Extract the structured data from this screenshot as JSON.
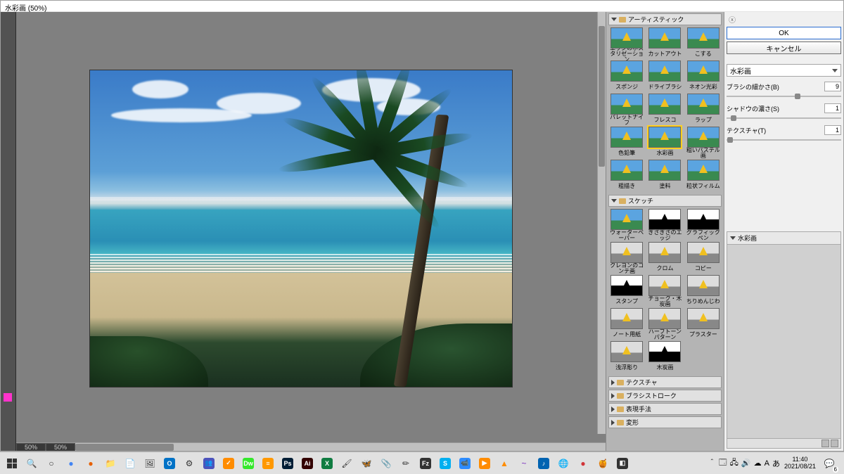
{
  "window": {
    "title": "水彩画 (50%)"
  },
  "zoom_readout": "50%",
  "bottom_zoom_alt": "50%",
  "categories": {
    "artistic": {
      "label": "アーティスティック",
      "filters": [
        {
          "name": "エッジのポスタリゼーション"
        },
        {
          "name": "カットアウト"
        },
        {
          "name": "こする"
        },
        {
          "name": "スポンジ"
        },
        {
          "name": "ドライブラシ"
        },
        {
          "name": "ネオン光彩"
        },
        {
          "name": "パレットナイフ"
        },
        {
          "name": "フレスコ"
        },
        {
          "name": "ラップ"
        },
        {
          "name": "色鉛筆"
        },
        {
          "name": "水彩画",
          "selected": true
        },
        {
          "name": "粗いパステル画"
        },
        {
          "name": "粗描き"
        },
        {
          "name": "塗料"
        },
        {
          "name": "粒状フィルム"
        }
      ]
    },
    "sketch": {
      "label": "スケッチ",
      "filters": [
        {
          "name": "ウォーターペーパー"
        },
        {
          "name": "ぎざぎざのエッジ",
          "bw": true
        },
        {
          "name": "グラフィックペン",
          "bw": true
        },
        {
          "name": "クレヨンのコンテ画",
          "gray": true
        },
        {
          "name": "クロム",
          "gray": true
        },
        {
          "name": "コピー",
          "gray": true
        },
        {
          "name": "スタンプ",
          "bw": true
        },
        {
          "name": "チョーク・木炭画",
          "gray": true
        },
        {
          "name": "ちりめんじわ",
          "gray": true
        },
        {
          "name": "ノート用紙",
          "gray": true
        },
        {
          "name": "ハーフトーンパターン",
          "gray": true
        },
        {
          "name": "プラスター",
          "gray": true
        },
        {
          "name": "浅浮彫り",
          "gray": true
        },
        {
          "name": "木炭画",
          "bw": true
        }
      ]
    },
    "closed": [
      {
        "label": "テクスチャ"
      },
      {
        "label": "ブラシストローク"
      },
      {
        "label": "表現手法"
      },
      {
        "label": "変形"
      }
    ]
  },
  "buttons": {
    "ok": "OK",
    "cancel": "キャンセル"
  },
  "filter_dropdown": "水彩画",
  "params": [
    {
      "label": "ブラシの細かさ(B)",
      "value": "9",
      "pos": 62
    },
    {
      "label": "シャドウの濃さ(S)",
      "value": "1",
      "pos": 6
    },
    {
      "label": "テクスチャ(T)",
      "value": "1",
      "pos": 3
    }
  ],
  "layer_stack_title": "水彩画",
  "taskbar_icons": [
    {
      "name": "search-icon",
      "glyph": "🔍",
      "bg": ""
    },
    {
      "name": "cortana-icon",
      "glyph": "○",
      "bg": ""
    },
    {
      "name": "chrome-icon",
      "glyph": "●",
      "bg": "",
      "color": "#4285f4"
    },
    {
      "name": "firefox-icon",
      "glyph": "●",
      "bg": "",
      "color": "#e66000"
    },
    {
      "name": "explorer-icon",
      "glyph": "📁",
      "bg": ""
    },
    {
      "name": "notes-icon",
      "glyph": "📄",
      "bg": ""
    },
    {
      "name": "photos-icon",
      "glyph": "🖼",
      "bg": ""
    },
    {
      "name": "outlook-icon",
      "glyph": "O",
      "bg": "#0072c6"
    },
    {
      "name": "settings-icon",
      "glyph": "⚙",
      "bg": ""
    },
    {
      "name": "teams-icon",
      "glyph": "👥",
      "bg": "#4b53bc"
    },
    {
      "name": "todo-icon",
      "glyph": "✓",
      "bg": "#ff8c00"
    },
    {
      "name": "dreamweaver-icon",
      "glyph": "Dw",
      "bg": "#35e82c"
    },
    {
      "name": "sublime-icon",
      "glyph": "≡",
      "bg": "#ff9800"
    },
    {
      "name": "photoshop-icon",
      "glyph": "Ps",
      "bg": "#001e36"
    },
    {
      "name": "illustrator-icon",
      "glyph": "Ai",
      "bg": "#330000"
    },
    {
      "name": "excel-icon",
      "glyph": "X",
      "bg": "#107c41"
    },
    {
      "name": "paint-icon",
      "glyph": "🖌",
      "bg": ""
    },
    {
      "name": "butterfly-icon",
      "glyph": "🦋",
      "bg": ""
    },
    {
      "name": "clip-icon",
      "glyph": "📎",
      "bg": ""
    },
    {
      "name": "wand-icon",
      "glyph": "✏",
      "bg": ""
    },
    {
      "name": "fz-icon",
      "glyph": "Fz",
      "bg": "#333"
    },
    {
      "name": "skype-icon",
      "glyph": "S",
      "bg": "#00aff0"
    },
    {
      "name": "zoom-icon",
      "glyph": "📹",
      "bg": "#2d8cff"
    },
    {
      "name": "media-icon",
      "glyph": "▶",
      "bg": "#ff8c00"
    },
    {
      "name": "vlc-icon",
      "glyph": "▲",
      "bg": "",
      "color": "#ff8c00"
    },
    {
      "name": "wave-icon",
      "glyph": "~",
      "bg": "",
      "color": "#7b2fbf"
    },
    {
      "name": "music-icon",
      "glyph": "♪",
      "bg": "#0063b1"
    },
    {
      "name": "globe-icon",
      "glyph": "🌐",
      "bg": "",
      "color": "#107c10"
    },
    {
      "name": "record-icon",
      "glyph": "●",
      "bg": "",
      "color": "#d13438"
    },
    {
      "name": "jar-icon",
      "glyph": "🍯",
      "bg": ""
    },
    {
      "name": "flag-icon",
      "glyph": "◧",
      "bg": "#333"
    }
  ],
  "tray": {
    "items": [
      {
        "name": "tray-chevron",
        "glyph": "＾"
      },
      {
        "name": "tray-battery",
        "glyph": "🗔"
      },
      {
        "name": "tray-network",
        "glyph": "🖧"
      },
      {
        "name": "tray-volume",
        "glyph": "🔊"
      },
      {
        "name": "tray-cloud",
        "glyph": "☁"
      },
      {
        "name": "tray-ime-a",
        "glyph": "A"
      },
      {
        "name": "tray-ime",
        "glyph": "あ"
      }
    ],
    "time": "11:40",
    "date": "2021/08/21",
    "notif_count": "6"
  }
}
